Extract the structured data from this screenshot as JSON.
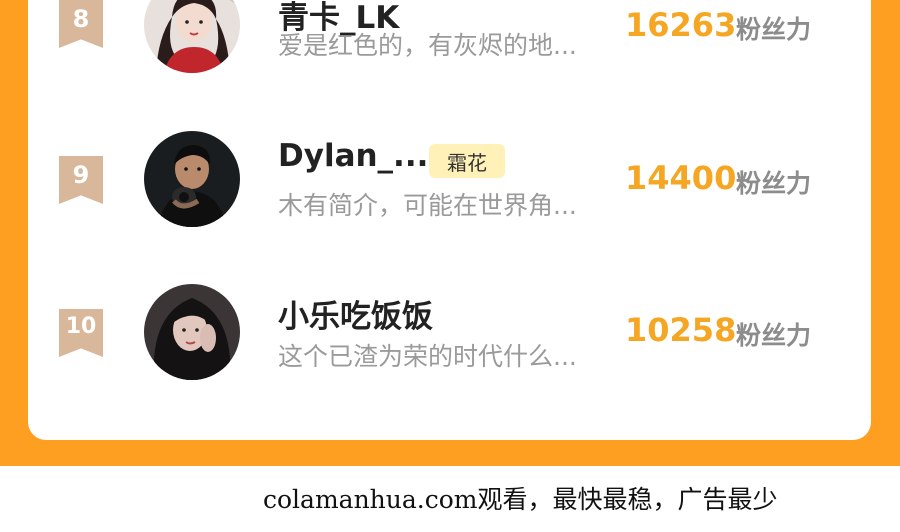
{
  "ranking": {
    "rows": [
      {
        "rank": "8",
        "name": "青卡_LK",
        "tag": "",
        "bio": "爱是红色的，有灰烬的地...",
        "count": "16263",
        "unit": "粉丝力",
        "avatar": "red-dress-girl-avatar"
      },
      {
        "rank": "9",
        "name": "Dylan_...",
        "tag": "霜花",
        "bio": "木有简介，可能在世界角...",
        "count": "14400",
        "unit": "粉丝力",
        "avatar": "dark-hoodie-boy-avatar"
      },
      {
        "rank": "10",
        "name": "小乐吃饭饭",
        "tag": "",
        "bio": "这个已渣为荣的时代什么...",
        "count": "10258",
        "unit": "粉丝力",
        "avatar": "dark-hair-girl-avatar"
      }
    ]
  },
  "footer": {
    "text": "colamanhua.com观看，最快最稳，广告最少"
  },
  "colors": {
    "background_orange": "#ff9f22",
    "count_yellow": "#f5a623",
    "tag_bg": "#fff1b8",
    "badge_tan": "#d8b79a"
  }
}
